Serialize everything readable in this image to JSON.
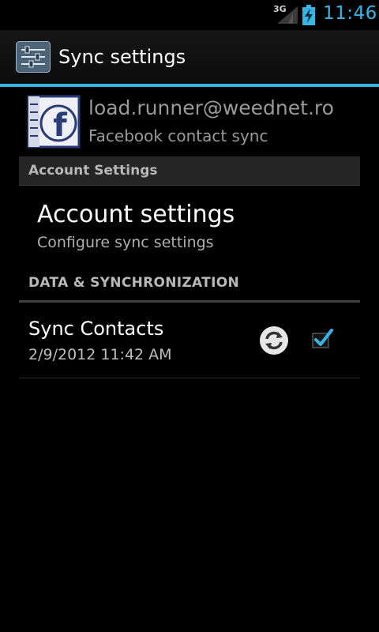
{
  "status_bar": {
    "network": "3G",
    "time": "11:46"
  },
  "action_bar": {
    "title": "Sync settings",
    "icon": "settings-sliders-icon"
  },
  "account": {
    "email": "load.runner@weednet.ro",
    "subtitle": "Facebook contact sync",
    "avatar_icon": "facebook-icon"
  },
  "sections": {
    "account_settings_header": "Account Settings",
    "data_sync_header": "DATA & SYNCHRONIZATION"
  },
  "account_settings_item": {
    "title": "Account settings",
    "summary": "Configure sync settings"
  },
  "sync_contacts": {
    "title": "Sync Contacts",
    "last_sync": "2/9/2012 11:42 AM",
    "checked": true,
    "sync_icon": "sync-icon"
  },
  "colors": {
    "accent": "#33b5e5",
    "background": "#000000",
    "secondary_text": "#9a9a9a"
  }
}
